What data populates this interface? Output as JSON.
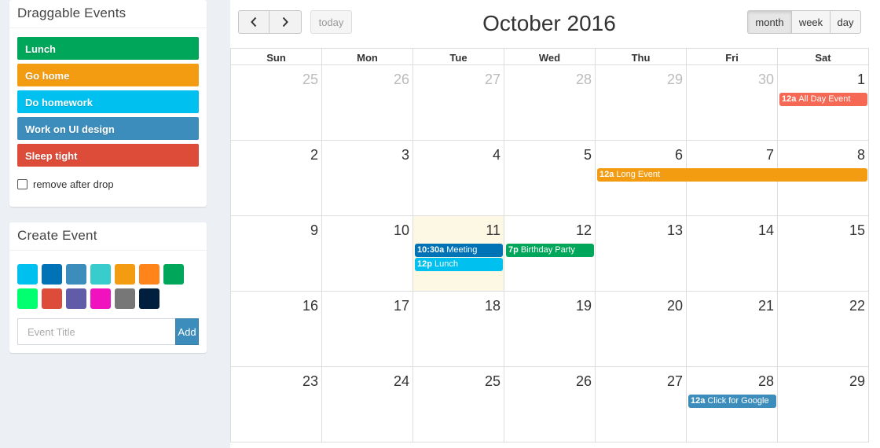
{
  "sidebar": {
    "draggable": {
      "title": "Draggable Events",
      "events": [
        {
          "label": "Lunch",
          "color": "#00a65a"
        },
        {
          "label": "Go home",
          "color": "#f39c12"
        },
        {
          "label": "Do homework",
          "color": "#00c0ef"
        },
        {
          "label": "Work on UI design",
          "color": "#3c8dbc"
        },
        {
          "label": "Sleep tight",
          "color": "#dd4b39"
        }
      ],
      "remove_label": "remove after drop",
      "remove_checked": false
    },
    "create": {
      "title": "Create Event",
      "colors_row1": [
        "#00c0ef",
        "#0073b7",
        "#3c8dbc",
        "#39cccc",
        "#f39c12",
        "#ff851b",
        "#00a65a"
      ],
      "colors_row2": [
        "#01ff70",
        "#dd4b39",
        "#605ca8",
        "#f012be",
        "#777777",
        "#001f3f"
      ],
      "input_placeholder": "Event Title",
      "add_label": "Add"
    }
  },
  "calendar": {
    "title": "October 2016",
    "today_label": "today",
    "views": {
      "month": "month",
      "week": "week",
      "day": "day",
      "active": "month"
    },
    "dow": [
      "Sun",
      "Mon",
      "Tue",
      "Wed",
      "Thu",
      "Fri",
      "Sat"
    ],
    "weeks": [
      {
        "days": [
          "25",
          "26",
          "27",
          "28",
          "29",
          "30",
          "1"
        ],
        "other": [
          true,
          true,
          true,
          true,
          true,
          true,
          false
        ]
      },
      {
        "days": [
          "2",
          "3",
          "4",
          "5",
          "6",
          "7",
          "8"
        ],
        "other": [
          false,
          false,
          false,
          false,
          false,
          false,
          false
        ]
      },
      {
        "days": [
          "9",
          "10",
          "11",
          "12",
          "13",
          "14",
          "15"
        ],
        "other": [
          false,
          false,
          false,
          false,
          false,
          false,
          false
        ],
        "today_index": 2
      },
      {
        "days": [
          "16",
          "17",
          "18",
          "19",
          "20",
          "21",
          "22"
        ],
        "other": [
          false,
          false,
          false,
          false,
          false,
          false,
          false
        ]
      },
      {
        "days": [
          "23",
          "24",
          "25",
          "26",
          "27",
          "28",
          "29"
        ],
        "other": [
          false,
          false,
          false,
          false,
          false,
          false,
          false
        ]
      }
    ],
    "events": [
      {
        "time": "12a",
        "title": "All Day Event",
        "week": 0,
        "start": 6,
        "span": 1,
        "slot": 0,
        "color": "#f56954"
      },
      {
        "time": "12a",
        "title": "Long Event",
        "week": 1,
        "start": 4,
        "span": 3,
        "slot": 0,
        "color": "#f39c12"
      },
      {
        "time": "10:30a",
        "title": "Meeting",
        "week": 2,
        "start": 2,
        "span": 1,
        "slot": 0,
        "color": "#0073b7"
      },
      {
        "time": "12p",
        "title": "Lunch",
        "week": 2,
        "start": 2,
        "span": 1,
        "slot": 1,
        "color": "#00c0ef"
      },
      {
        "time": "7p",
        "title": "Birthday Party",
        "week": 2,
        "start": 3,
        "span": 1,
        "slot": 0,
        "color": "#00a65a"
      },
      {
        "time": "12a",
        "title": "Click for Google",
        "week": 4,
        "start": 5,
        "span": 1,
        "slot": 0,
        "color": "#3c8dbc"
      }
    ]
  }
}
